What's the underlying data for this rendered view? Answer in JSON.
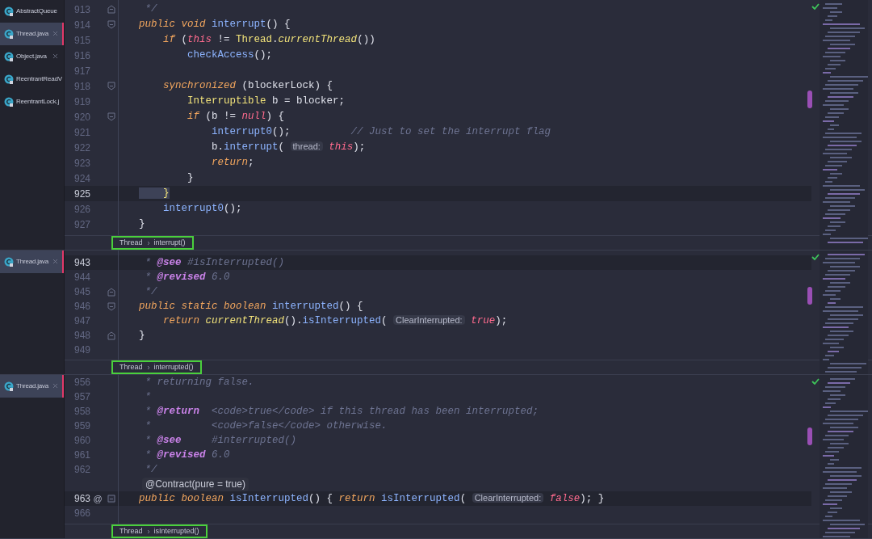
{
  "panes": [
    {
      "tabs": [
        {
          "label": "AbstractQueue",
          "selected": false,
          "closable": false
        },
        {
          "label": "Thread.java",
          "selected": true,
          "closable": true
        },
        {
          "label": "Object.java",
          "selected": false,
          "closable": true
        },
        {
          "label": "ReentrantReadV",
          "selected": false,
          "closable": false
        },
        {
          "label": "ReentrantLock.j",
          "selected": false,
          "closable": false
        }
      ],
      "lines": [
        {
          "number": "913",
          "current": false,
          "fold_start": false,
          "fold_end": true,
          "tokens": [
            {
              "kind": "comment",
              "text": " */"
            }
          ]
        },
        {
          "number": "914",
          "current": false,
          "fold_start": true,
          "fold_end": false,
          "tokens": [
            {
              "kind": "kw",
              "text": "public"
            },
            {
              "kind": "kw",
              "text": " void"
            },
            {
              "kind": "method",
              "text": " interrupt"
            },
            {
              "kind": "plain",
              "text": "() {"
            }
          ]
        },
        {
          "number": "915",
          "current": false,
          "fold_start": false,
          "fold_end": false,
          "tokens": [
            {
              "kind": "kw",
              "text": "    if"
            },
            {
              "kind": "plain",
              "text": " ("
            },
            {
              "kind": "lit",
              "text": "this"
            },
            {
              "kind": "plain",
              "text": " != "
            },
            {
              "kind": "type",
              "text": "Thread"
            },
            {
              "kind": "plain",
              "text": "."
            },
            {
              "kind": "static",
              "text": "currentThread"
            },
            {
              "kind": "plain",
              "text": "())"
            }
          ]
        },
        {
          "number": "916",
          "current": false,
          "fold_start": false,
          "fold_end": false,
          "tokens": [
            {
              "kind": "method",
              "text": "        checkAccess"
            },
            {
              "kind": "plain",
              "text": "();"
            }
          ]
        },
        {
          "number": "917",
          "current": false,
          "fold_start": false,
          "fold_end": false
        },
        {
          "number": "918",
          "current": false,
          "fold_start": true,
          "fold_end": false,
          "tokens": [
            {
              "kind": "kw",
              "text": "    synchronized"
            },
            {
              "kind": "plain",
              "text": " (blockerLock) {"
            }
          ]
        },
        {
          "number": "919",
          "current": false,
          "fold_start": false,
          "fold_end": false,
          "tokens": [
            {
              "kind": "type",
              "text": "        Interruptible"
            },
            {
              "kind": "plain",
              "text": " b = blocker;"
            }
          ]
        },
        {
          "number": "920",
          "current": false,
          "fold_start": true,
          "fold_end": false,
          "tokens": [
            {
              "kind": "kw",
              "text": "        if"
            },
            {
              "kind": "plain",
              "text": " (b != "
            },
            {
              "kind": "lit",
              "text": "null"
            },
            {
              "kind": "plain",
              "text": ") {"
            }
          ]
        },
        {
          "number": "921",
          "current": false,
          "fold_start": false,
          "fold_end": false,
          "tokens": [
            {
              "kind": "method",
              "text": "            interrupt0"
            },
            {
              "kind": "plain",
              "text": "();"
            },
            {
              "kind": "comment",
              "text": "          // Just to set the interrupt flag"
            }
          ]
        },
        {
          "number": "922",
          "current": false,
          "fold_start": false,
          "fold_end": false,
          "tokens": [
            {
              "kind": "plain",
              "text": "            b."
            },
            {
              "kind": "method",
              "text": "interrupt"
            },
            {
              "kind": "plain",
              "text": "( "
            },
            {
              "kind": "hint",
              "text": "thread:"
            },
            {
              "kind": "lit",
              "text": " this"
            },
            {
              "kind": "plain",
              "text": ");"
            }
          ]
        },
        {
          "number": "923",
          "current": false,
          "fold_start": false,
          "fold_end": false,
          "tokens": [
            {
              "kind": "kw",
              "text": "            return"
            },
            {
              "kind": "plain",
              "text": ";"
            }
          ]
        },
        {
          "number": "924",
          "current": false,
          "fold_start": false,
          "fold_end": false,
          "tokens": [
            {
              "kind": "plain",
              "text": "        }"
            }
          ]
        },
        {
          "number": "925",
          "current": true,
          "fold_start": false,
          "fold_end": false,
          "tokens": [
            {
              "kind": "brace",
              "text": "    }"
            }
          ]
        },
        {
          "number": "926",
          "current": false,
          "fold_start": false,
          "fold_end": false,
          "tokens": [
            {
              "kind": "method",
              "text": "    interrupt0"
            },
            {
              "kind": "plain",
              "text": "();"
            }
          ]
        },
        {
          "number": "927",
          "current": false,
          "fold_start": false,
          "fold_end": false,
          "tokens": [
            {
              "kind": "plain",
              "text": "}"
            }
          ]
        }
      ],
      "breadcrumb": {
        "highlighted": true,
        "items": [
          "Thread",
          "interrupt()"
        ]
      }
    },
    {
      "tabs": [
        {
          "label": "Thread.java",
          "selected": true,
          "closable": true
        }
      ],
      "lines": [
        {
          "number": "943",
          "current": true,
          "fold_start": false,
          "fold_end": false,
          "tokens": [
            {
              "kind": "comment",
              "text": " *"
            },
            {
              "kind": "doctag",
              "text": " @see"
            },
            {
              "kind": "comment",
              "text": " #isInterrupted()"
            }
          ]
        },
        {
          "number": "944",
          "current": false,
          "fold_start": false,
          "fold_end": false,
          "tokens": [
            {
              "kind": "comment",
              "text": " *"
            },
            {
              "kind": "doctag",
              "text": " @revised"
            },
            {
              "kind": "comment",
              "text": " 6.0"
            }
          ]
        },
        {
          "number": "945",
          "current": false,
          "fold_start": false,
          "fold_end": true,
          "tokens": [
            {
              "kind": "comment",
              "text": " */"
            }
          ]
        },
        {
          "number": "946",
          "current": false,
          "fold_start": true,
          "fold_end": false,
          "tokens": [
            {
              "kind": "kw",
              "text": "public"
            },
            {
              "kind": "kw",
              "text": " static"
            },
            {
              "kind": "kw",
              "text": " boolean"
            },
            {
              "kind": "method",
              "text": " interrupted"
            },
            {
              "kind": "plain",
              "text": "() {"
            }
          ]
        },
        {
          "number": "947",
          "current": false,
          "fold_start": false,
          "fold_end": false,
          "tokens": [
            {
              "kind": "kw",
              "text": "    return"
            },
            {
              "kind": "static",
              "text": " currentThread"
            },
            {
              "kind": "plain",
              "text": "()."
            },
            {
              "kind": "method",
              "text": "isInterrupted"
            },
            {
              "kind": "plain",
              "text": "( "
            },
            {
              "kind": "hint",
              "text": "ClearInterrupted:"
            },
            {
              "kind": "lit",
              "text": " true"
            },
            {
              "kind": "plain",
              "text": ");"
            }
          ]
        },
        {
          "number": "948",
          "current": false,
          "fold_start": false,
          "fold_end": true,
          "tokens": [
            {
              "kind": "plain",
              "text": "}"
            }
          ]
        },
        {
          "number": "949",
          "current": false,
          "fold_start": false,
          "fold_end": false
        }
      ],
      "breadcrumb": {
        "highlighted": true,
        "items": [
          "Thread",
          "interrupted()"
        ]
      }
    },
    {
      "tabs": [
        {
          "label": "Thread.java",
          "selected": true,
          "closable": true
        }
      ],
      "lines": [
        {
          "number": "956",
          "current": false,
          "fold_start": false,
          "fold_end": false,
          "tokens": [
            {
              "kind": "comment",
              "text": " * returning false."
            }
          ]
        },
        {
          "number": "957",
          "current": false,
          "fold_start": false,
          "fold_end": false,
          "tokens": [
            {
              "kind": "comment",
              "text": " *"
            }
          ]
        },
        {
          "number": "958",
          "current": false,
          "fold_start": false,
          "fold_end": false,
          "tokens": [
            {
              "kind": "comment",
              "text": " *"
            },
            {
              "kind": "doctag",
              "text": " @return"
            },
            {
              "kind": "comment",
              "text": "  <code>true</code> if this thread has been interrupted;"
            }
          ]
        },
        {
          "number": "959",
          "current": false,
          "fold_start": false,
          "fold_end": false,
          "tokens": [
            {
              "kind": "comment",
              "text": " *          <code>false</code> otherwise."
            }
          ]
        },
        {
          "number": "960",
          "current": false,
          "fold_start": false,
          "fold_end": false,
          "tokens": [
            {
              "kind": "comment",
              "text": " *"
            },
            {
              "kind": "doctag",
              "text": " @see"
            },
            {
              "kind": "comment",
              "text": "     #interrupted()"
            }
          ]
        },
        {
          "number": "961",
          "current": false,
          "fold_start": false,
          "fold_end": false,
          "tokens": [
            {
              "kind": "comment",
              "text": " *"
            },
            {
              "kind": "doctag",
              "text": " @revised"
            },
            {
              "kind": "comment",
              "text": " 6.0"
            }
          ]
        },
        {
          "number": "962",
          "current": false,
          "fold_start": false,
          "fold_end": false,
          "tokens": [
            {
              "kind": "comment",
              "text": " */"
            }
          ]
        },
        {
          "kind": "annotation",
          "text": "@Contract(pure = true)"
        },
        {
          "number": "963",
          "current": true,
          "marker": "@",
          "fold_start": true,
          "fold_end": true,
          "tokens": [
            {
              "kind": "kw",
              "text": "public"
            },
            {
              "kind": "kw",
              "text": " boolean"
            },
            {
              "kind": "method",
              "text": " isInterrupted"
            },
            {
              "kind": "plain",
              "text": "() {"
            },
            {
              "kind": "kw",
              "text": " return"
            },
            {
              "kind": "method",
              "text": " isInterrupted"
            },
            {
              "kind": "plain",
              "text": "( "
            },
            {
              "kind": "hint",
              "text": "ClearInterrupted:"
            },
            {
              "kind": "lit",
              "text": " false"
            },
            {
              "kind": "plain",
              "text": "); }"
            }
          ]
        },
        {
          "number": "966",
          "current": false,
          "fold_start": false,
          "fold_end": false
        }
      ],
      "breadcrumb": {
        "highlighted": true,
        "items": [
          "Thread",
          "isInterrupted()"
        ]
      }
    }
  ]
}
